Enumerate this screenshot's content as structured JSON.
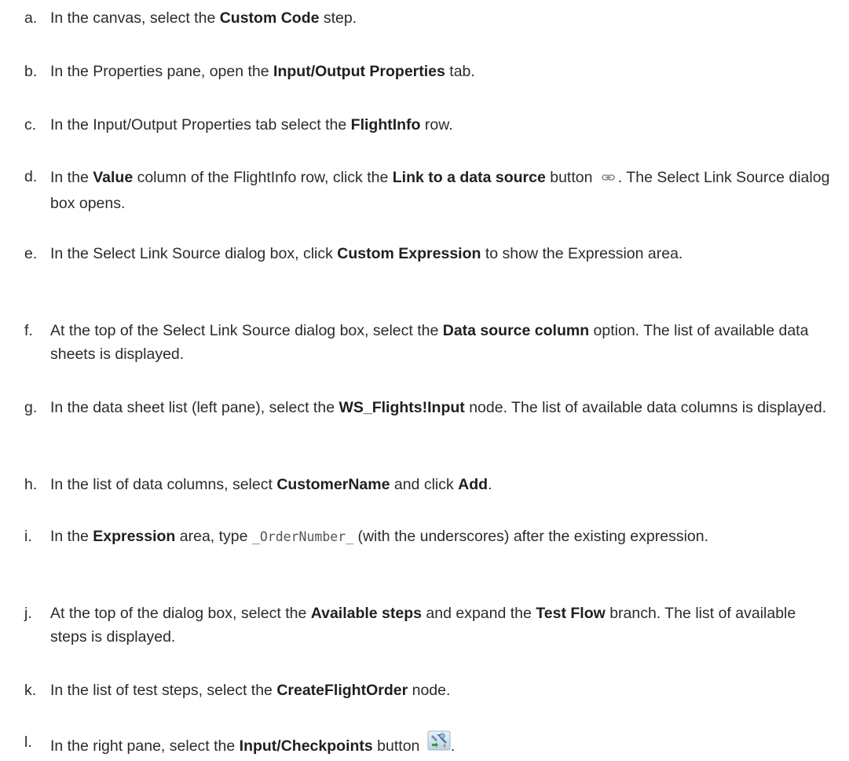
{
  "steps": [
    {
      "marker": "a.",
      "segments": [
        {
          "t": "In the canvas, select the "
        },
        {
          "t": "Custom Code",
          "b": true
        },
        {
          "t": " step."
        }
      ]
    },
    {
      "marker": "b.",
      "segments": [
        {
          "t": "In the Properties pane, open the "
        },
        {
          "t": "Input/Output Properties",
          "b": true
        },
        {
          "t": " tab."
        }
      ]
    },
    {
      "marker": "c.",
      "segments": [
        {
          "t": "In the Input/Output Properties tab select the "
        },
        {
          "t": "FlightInfo",
          "b": true
        },
        {
          "t": " row."
        }
      ]
    },
    {
      "marker": "d.",
      "segments": [
        {
          "t": "In the "
        },
        {
          "t": "Value",
          "b": true
        },
        {
          "t": " column of the FlightInfo row, click the "
        },
        {
          "t": "Link to a data source",
          "b": true
        },
        {
          "t": " button "
        },
        {
          "icon": "link-icon"
        },
        {
          "t": ". The Select Link Source dialog box opens."
        }
      ]
    },
    {
      "marker": "e.",
      "segments": [
        {
          "t": "In the Select Link Source dialog box, click "
        },
        {
          "t": "Custom Expression",
          "b": true
        },
        {
          "t": " to show the Expression area."
        }
      ]
    },
    {
      "marker": "f.",
      "segments": [
        {
          "t": "At the top of the Select Link Source dialog box, select the "
        },
        {
          "t": "Data source column",
          "b": true
        },
        {
          "t": " option. The list of available data sheets is displayed."
        }
      ]
    },
    {
      "marker": "g.",
      "segments": [
        {
          "t": "In the data sheet list (left pane), select the "
        },
        {
          "t": "WS_Flights!Input",
          "b": true
        },
        {
          "t": " node. The list of available data columns is displayed."
        }
      ]
    },
    {
      "marker": "h.",
      "segments": [
        {
          "t": "In the list of data columns, select "
        },
        {
          "t": "CustomerName",
          "b": true
        },
        {
          "t": " and click "
        },
        {
          "t": "Add",
          "b": true
        },
        {
          "t": "."
        }
      ]
    },
    {
      "marker": "i.",
      "segments": [
        {
          "t": "In the "
        },
        {
          "t": "Expression",
          "b": true
        },
        {
          "t": " area, type "
        },
        {
          "t": "_OrderNumber_",
          "code": true
        },
        {
          "t": " (with the underscores) after the existing expression."
        }
      ]
    },
    {
      "marker": "j.",
      "segments": [
        {
          "t": "At the top of the dialog box, select the "
        },
        {
          "t": "Available steps",
          "b": true
        },
        {
          "t": " and expand the "
        },
        {
          "t": "Test Flow",
          "b": true
        },
        {
          "t": " branch. The list of available steps is displayed."
        }
      ]
    },
    {
      "marker": "k.",
      "segments": [
        {
          "t": "In the list of test steps, select the "
        },
        {
          "t": "CreateFlightOrder",
          "b": true
        },
        {
          "t": " node."
        }
      ]
    },
    {
      "marker": "l.",
      "segments": [
        {
          "t": "In the right pane, select the "
        },
        {
          "t": "Input/Checkpoints",
          "b": true
        },
        {
          "t": " button "
        },
        {
          "icon": "input-checkpoints-icon"
        },
        {
          "t": "."
        }
      ]
    }
  ]
}
